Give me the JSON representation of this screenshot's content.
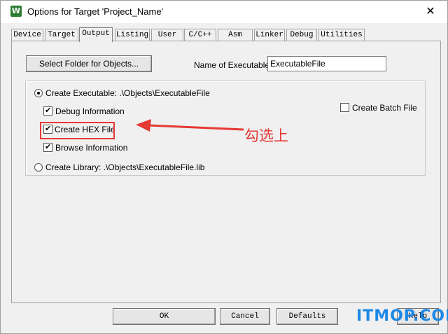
{
  "window": {
    "title": "Options for Target 'Project_Name'",
    "icon_glyph": "W",
    "close_glyph": "✕"
  },
  "tabs": [
    {
      "label": "Device",
      "active": false
    },
    {
      "label": "Target",
      "active": false
    },
    {
      "label": "Output",
      "active": true
    },
    {
      "label": "Listing",
      "active": false
    },
    {
      "label": "User",
      "active": false
    },
    {
      "label": "C/C++",
      "active": false
    },
    {
      "label": "Asm",
      "active": false
    },
    {
      "label": "Linker",
      "active": false
    },
    {
      "label": "Debug",
      "active": false
    },
    {
      "label": "Utilities",
      "active": false
    }
  ],
  "output": {
    "select_folder_label": "Select Folder for Objects...",
    "name_of_executable_label": "Name of Executable:",
    "name_of_executable_value": "ExecutableFile",
    "create_executable_label": "Create Executable:  .\\Objects\\ExecutableFile",
    "create_executable_checked": true,
    "debug_information_label": "Debug Information",
    "debug_information_checked": true,
    "create_hex_label": "Create HEX File",
    "create_hex_checked": true,
    "browse_information_label": "Browse Information",
    "browse_information_checked": true,
    "create_library_label": "Create Library:  .\\Objects\\ExecutableFile.lib",
    "create_library_checked": false,
    "create_batch_label": "Create Batch File",
    "create_batch_checked": false
  },
  "annotation": {
    "text": "勾选上",
    "color": "#e53935"
  },
  "footer": {
    "ok_label": "OK",
    "cancel_label": "Cancel",
    "defaults_label": "Defaults",
    "help_label": "Help"
  },
  "watermark": {
    "text": "ITMOP.COM",
    "color": "#1e88e5"
  }
}
